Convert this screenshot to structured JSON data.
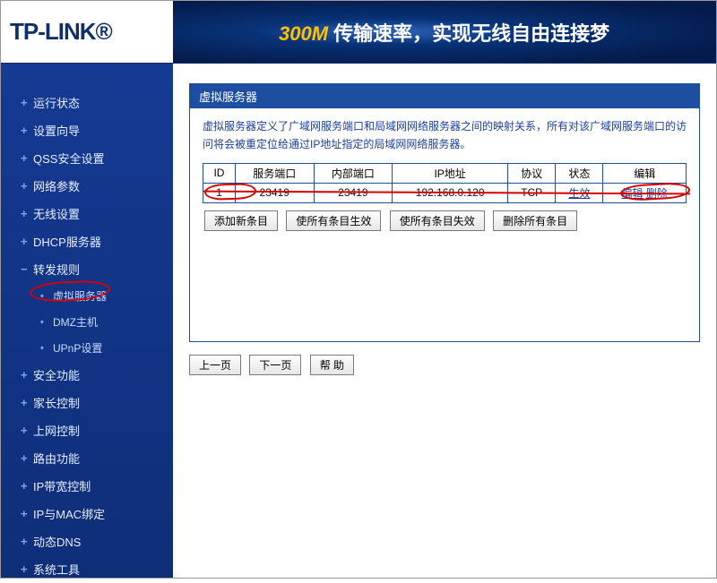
{
  "brand": {
    "logo": "TP-LINK®"
  },
  "banner": {
    "accent": "300M",
    "text": " 传输速率，实现无线自由连接梦"
  },
  "sidebar": {
    "items": [
      {
        "label": "运行状态",
        "marker": "plus",
        "sub": false
      },
      {
        "label": "设置向导",
        "marker": "plus",
        "sub": false
      },
      {
        "label": "QSS安全设置",
        "marker": "plus",
        "sub": false
      },
      {
        "label": "网络参数",
        "marker": "plus",
        "sub": false
      },
      {
        "label": "无线设置",
        "marker": "plus",
        "sub": false
      },
      {
        "label": "DHCP服务器",
        "marker": "plus",
        "sub": false
      },
      {
        "label": "转发规则",
        "marker": "minus",
        "sub": false
      },
      {
        "label": "虚拟服务器",
        "marker": "dot",
        "sub": true,
        "highlight": true
      },
      {
        "label": "DMZ主机",
        "marker": "dot",
        "sub": true
      },
      {
        "label": "UPnP设置",
        "marker": "dot",
        "sub": true
      },
      {
        "label": "安全功能",
        "marker": "plus",
        "sub": false
      },
      {
        "label": "家长控制",
        "marker": "plus",
        "sub": false
      },
      {
        "label": "上网控制",
        "marker": "plus",
        "sub": false
      },
      {
        "label": "路由功能",
        "marker": "plus",
        "sub": false
      },
      {
        "label": "IP带宽控制",
        "marker": "plus",
        "sub": false
      },
      {
        "label": "IP与MAC绑定",
        "marker": "plus",
        "sub": false
      },
      {
        "label": "动态DNS",
        "marker": "plus",
        "sub": false
      },
      {
        "label": "系统工具",
        "marker": "plus",
        "sub": false
      }
    ]
  },
  "panel": {
    "title": "虚拟服务器",
    "description": "虚拟服务器定义了广域网服务端口和局域网网络服务器之间的映射关系，所有对该广域网服务端口的访问将会被重定位给通过IP地址指定的局域网网络服务器。",
    "headers": {
      "id": "ID",
      "service_port": "服务端口",
      "internal_port": "内部端口",
      "ip": "IP地址",
      "protocol": "协议",
      "status": "状态",
      "edit": "编辑"
    },
    "rows": [
      {
        "id": "1",
        "service_port": "23419",
        "internal_port": "23419",
        "ip": "192.168.0.120",
        "protocol": "TCP",
        "status": "生效",
        "edit_label": "编辑",
        "delete_label": "删除"
      }
    ],
    "actions": {
      "add": "添加新条目",
      "enable_all": "使所有条目生效",
      "disable_all": "使所有条目失效",
      "delete_all": "删除所有条目"
    },
    "pager": {
      "prev": "上一页",
      "next": "下一页",
      "help": "帮 助"
    }
  }
}
